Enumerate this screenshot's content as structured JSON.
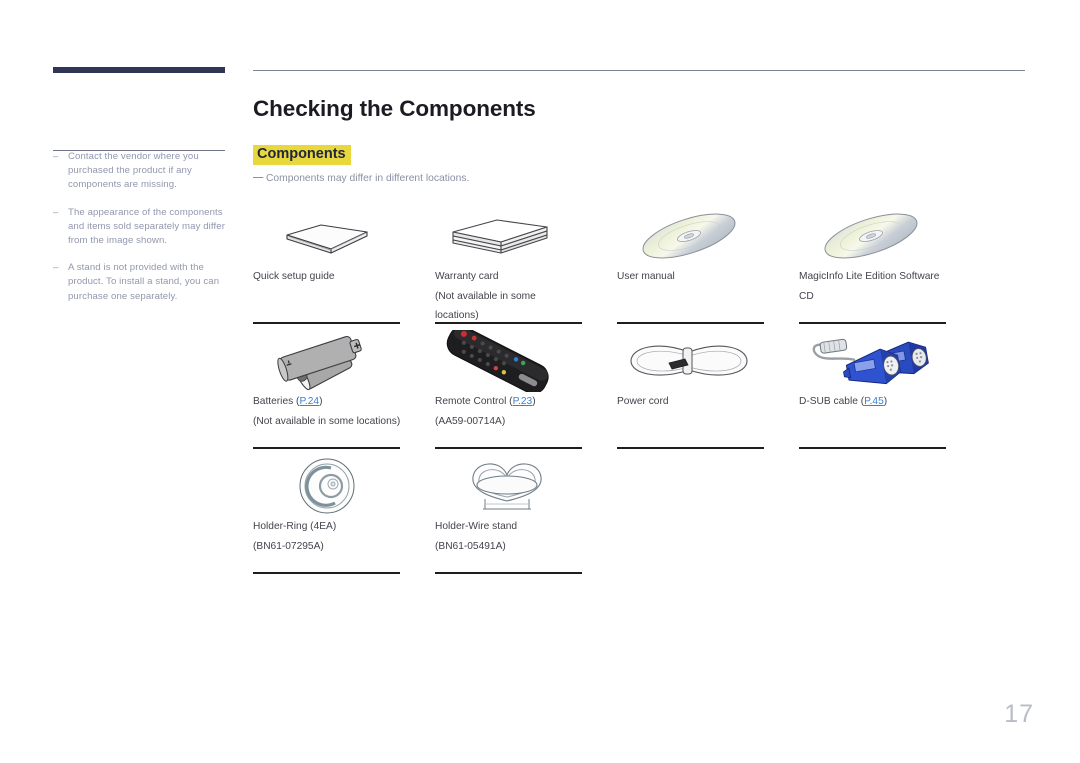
{
  "document": {
    "page_number": "17",
    "title": "Checking the Components",
    "section_heading": "Components",
    "section_note": "Components may differ in different locations.",
    "dash": "—",
    "bullet_dash": "–",
    "accent_navy": "#2f3557",
    "highlight_yellow": "#e8d83c",
    "link_blue": "#3a7fd5"
  },
  "sidebar": {
    "notes": [
      "Contact the vendor where you purchased the product if any components are missing.",
      "The appearance of the components and items sold separately may differ from the image shown.",
      "A stand is not provided with the product. To install a stand, you can purchase one separately."
    ]
  },
  "components": [
    {
      "icon": "quick-setup-guide-icon",
      "line1": "Quick setup guide",
      "line2": "",
      "line3": ""
    },
    {
      "icon": "warranty-card-icon",
      "line1": "Warranty card",
      "line2": "(Not available in some",
      "line3": "locations)"
    },
    {
      "icon": "user-manual-cd-icon",
      "line1": "User manual",
      "line2": "",
      "line3": ""
    },
    {
      "icon": "magicinfo-cd-icon",
      "line1": "MagicInfo Lite Edition Software",
      "line2": "CD",
      "line3": ""
    },
    {
      "icon": "batteries-icon",
      "line1": "Batteries (",
      "link": "P.24",
      "line1_suffix": ")",
      "line2": "(Not available in some locations)",
      "line3": ""
    },
    {
      "icon": "remote-control-icon",
      "line1": "Remote Control (",
      "link": "P.23",
      "line1_suffix": ")",
      "line2": "(AA59-00714A)",
      "line3": ""
    },
    {
      "icon": "power-cord-icon",
      "line1": "Power cord",
      "line2": "",
      "line3": ""
    },
    {
      "icon": "d-sub-cable-icon",
      "line1": "D-SUB cable (",
      "link": "P.45",
      "line1_suffix": ")",
      "line2": "",
      "line3": ""
    },
    {
      "icon": "holder-ring-icon",
      "line1": "Holder-Ring (4EA)",
      "line2": "(BN61-07295A)",
      "line3": ""
    },
    {
      "icon": "holder-wire-stand-icon",
      "line1": "Holder-Wire stand",
      "line2": "(BN61-05491A)",
      "line3": ""
    }
  ]
}
